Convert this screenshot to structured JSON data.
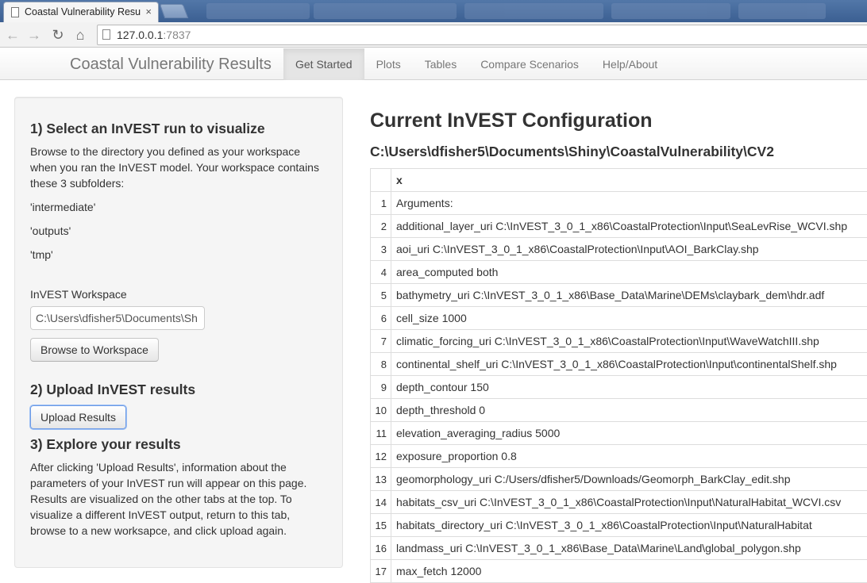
{
  "browser": {
    "tab_title": "Coastal Vulnerability Resu",
    "tab_close": "×",
    "url_host": "127.0.0.1",
    "url_port": ":7837"
  },
  "nav": {
    "brand": "Coastal Vulnerability Results",
    "links": [
      "Get Started",
      "Plots",
      "Tables",
      "Compare Scenarios",
      "Help/About"
    ]
  },
  "sidebar": {
    "step1_title": "1) Select an InVEST run to visualize",
    "step1_text": "Browse to the directory you defined as your workspace when you ran the InVEST model. Your workspace contains these 3 subfolders:",
    "subfolders": [
      "'intermediate'",
      "'outputs'",
      "'tmp'"
    ],
    "workspace_label": "InVEST Workspace",
    "workspace_value": "C:\\Users\\dfisher5\\Documents\\Sh",
    "browse_label": "Browse to Workspace",
    "step2_title": "2) Upload InVEST results",
    "upload_label": "Upload Results",
    "step3_title": "3) Explore your results",
    "step3_text": "After clicking 'Upload Results', information about the parameters of your InVEST run will appear on this page. Results are visualized on the other tabs at the top. To visualize a different InVEST output, return to this tab, browse to a new worksapce, and click upload again."
  },
  "main": {
    "title": "Current InVEST Configuration",
    "path": "C:\\Users\\dfisher5\\Documents\\Shiny\\CoastalVulnerability\\CV2",
    "table_header": "x",
    "rows": [
      {
        "idx": "1",
        "value": "Arguments:"
      },
      {
        "idx": "2",
        "value": "additional_layer_uri C:\\InVEST_3_0_1_x86\\CoastalProtection\\Input\\SeaLevRise_WCVI.shp"
      },
      {
        "idx": "3",
        "value": "aoi_uri C:\\InVEST_3_0_1_x86\\CoastalProtection\\Input\\AOI_BarkClay.shp"
      },
      {
        "idx": "4",
        "value": "area_computed both"
      },
      {
        "idx": "5",
        "value": "bathymetry_uri C:\\InVEST_3_0_1_x86\\Base_Data\\Marine\\DEMs\\claybark_dem\\hdr.adf"
      },
      {
        "idx": "6",
        "value": "cell_size 1000"
      },
      {
        "idx": "7",
        "value": "climatic_forcing_uri C:\\InVEST_3_0_1_x86\\CoastalProtection\\Input\\WaveWatchIII.shp"
      },
      {
        "idx": "8",
        "value": "continental_shelf_uri C:\\InVEST_3_0_1_x86\\CoastalProtection\\Input\\continentalShelf.shp"
      },
      {
        "idx": "9",
        "value": "depth_contour 150"
      },
      {
        "idx": "10",
        "value": "depth_threshold 0"
      },
      {
        "idx": "11",
        "value": "elevation_averaging_radius 5000"
      },
      {
        "idx": "12",
        "value": "exposure_proportion 0.8"
      },
      {
        "idx": "13",
        "value": "geomorphology_uri C:/Users/dfisher5/Downloads/Geomorph_BarkClay_edit.shp"
      },
      {
        "idx": "14",
        "value": "habitats_csv_uri C:\\InVEST_3_0_1_x86\\CoastalProtection\\Input\\NaturalHabitat_WCVI.csv"
      },
      {
        "idx": "15",
        "value": "habitats_directory_uri C:\\InVEST_3_0_1_x86\\CoastalProtection\\Input\\NaturalHabitat"
      },
      {
        "idx": "16",
        "value": "landmass_uri C:\\InVEST_3_0_1_x86\\Base_Data\\Marine\\Land\\global_polygon.shp"
      },
      {
        "idx": "17",
        "value": "max_fetch 12000"
      }
    ]
  }
}
